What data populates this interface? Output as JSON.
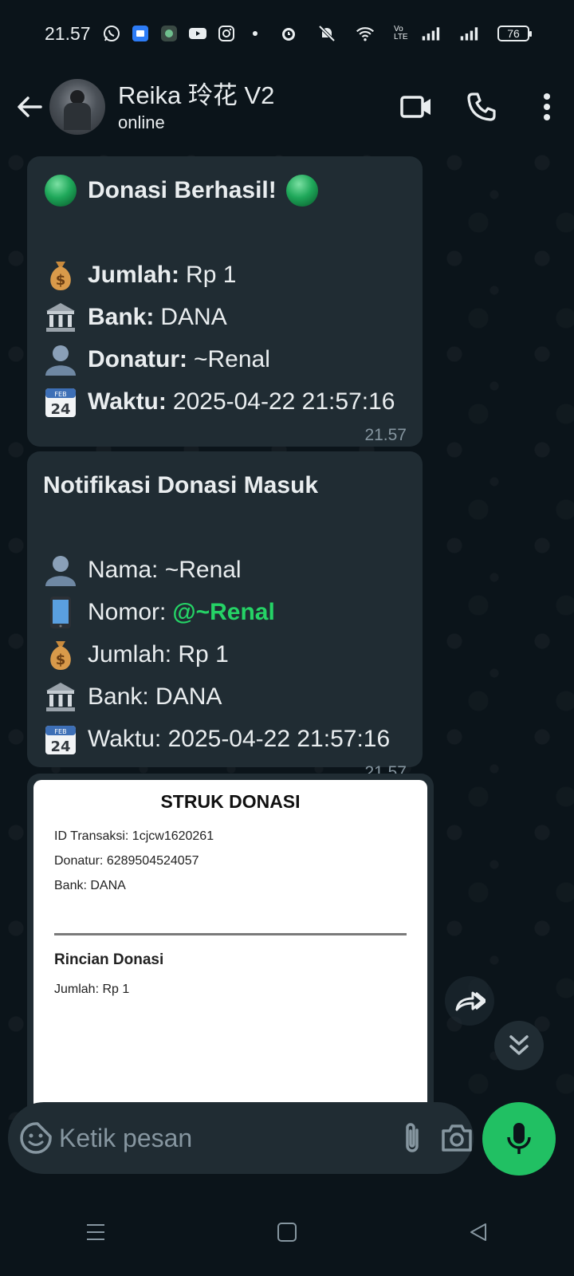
{
  "status_bar": {
    "time": "21.57",
    "battery": "76",
    "lte_label": "Vo LTE"
  },
  "header": {
    "title": "Reika 玲花 V2",
    "subtitle": "online"
  },
  "messages": [
    {
      "heading": "Donasi Berhasil!",
      "lines": [
        {
          "icon": "money-bag-icon",
          "label": "Jumlah:",
          "value": "Rp 1"
        },
        {
          "icon": "bank-icon",
          "label": "Bank:",
          "value": "DANA"
        },
        {
          "icon": "person-icon",
          "label": "Donatur:",
          "value": "~Renal"
        },
        {
          "icon": "calendar-icon",
          "label": "Waktu:",
          "value": "2025-04-22 21:57:16"
        }
      ],
      "time": "21.57"
    },
    {
      "heading": "Notifikasi Donasi Masuk",
      "lines": [
        {
          "icon": "person-icon",
          "text": "Nama: ~Renal"
        },
        {
          "icon": "phone-icon",
          "text": "Nomor:",
          "mention": "@~Renal"
        },
        {
          "icon": "money-bag-icon",
          "text": "Jumlah: Rp 1"
        },
        {
          "icon": "bank-icon",
          "text": "Bank: DANA"
        },
        {
          "icon": "calendar-icon",
          "text": "Waktu: 2025-04-22 21:57:16"
        }
      ],
      "time": "21.57"
    }
  ],
  "receipt": {
    "title": "STRUK DONASI",
    "transaction_id": "ID Transaksi: 1cjcw1620261",
    "donor": "Donatur: 6289504524057",
    "bank": "Bank: DANA",
    "section_title": "Rincian Donasi",
    "amount": "Jumlah: Rp 1"
  },
  "input": {
    "placeholder": "Ketik pesan"
  },
  "colors": {
    "background": "#0b141a",
    "bubble": "#202c33",
    "accent": "#21c063",
    "mention": "#25d366",
    "secondary_text": "#8696a0"
  }
}
